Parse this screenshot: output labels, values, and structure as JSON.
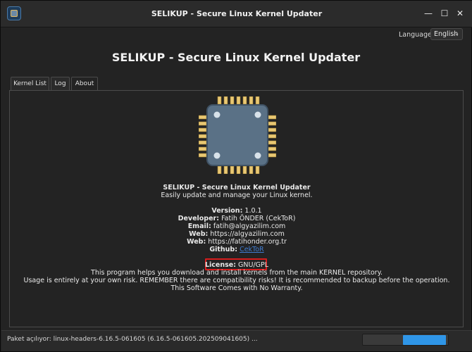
{
  "window": {
    "title": "SELIKUP - Secure Linux Kernel Updater",
    "minimize_glyph": "—",
    "maximize_glyph": "☐",
    "close_glyph": "✕"
  },
  "header": {
    "language_label": "Language:",
    "language_value": "English",
    "title": "SELIKUP - Secure Linux Kernel Updater"
  },
  "tabs": [
    {
      "label": "Kernel List",
      "active": false
    },
    {
      "label": "Log",
      "active": false
    },
    {
      "label": "About",
      "active": true
    }
  ],
  "about": {
    "icon": "chip-icon",
    "name": "SELIKUP - Secure Linux Kernel Updater",
    "tagline": "Easily update and manage your Linux kernel.",
    "version_label": "Version:",
    "version_value": "1.0.1",
    "developer_label": "Developer:",
    "developer_value": "Fatih ÖNDER (CekToR)",
    "email_label": "Email:",
    "email_value": "fatih@algyazilim.com",
    "web1_label": "Web:",
    "web1_value": "https://algyazilim.com",
    "web2_label": "Web:",
    "web2_value": "https://fatihonder.org.tr",
    "github_label": "Github:",
    "github_value": "CekToR",
    "license_label": "License:",
    "license_value": "GNU/GPL",
    "description": "This program helps you download and install kernels from the main KERNEL repository.",
    "warning": "Usage is entirely at your own risk. REMEMBER there are compatibility risks! It is recommended to backup before the operation.",
    "warranty": "This Software Comes with No Warranty."
  },
  "status": {
    "text": "Paket açılıyor: linux-headers-6.16.5-061605 (6.16.5-061605.202509041605) ...",
    "progress_color": "#2f96e8",
    "progress_indicator_start": 0.47,
    "progress_indicator_length": 0.5
  },
  "colors": {
    "background": "#232323",
    "link": "#3f7cd1",
    "highlight": "#d71d1d",
    "chip_body": "#5a7186",
    "chip_pins": "#e9c873"
  }
}
